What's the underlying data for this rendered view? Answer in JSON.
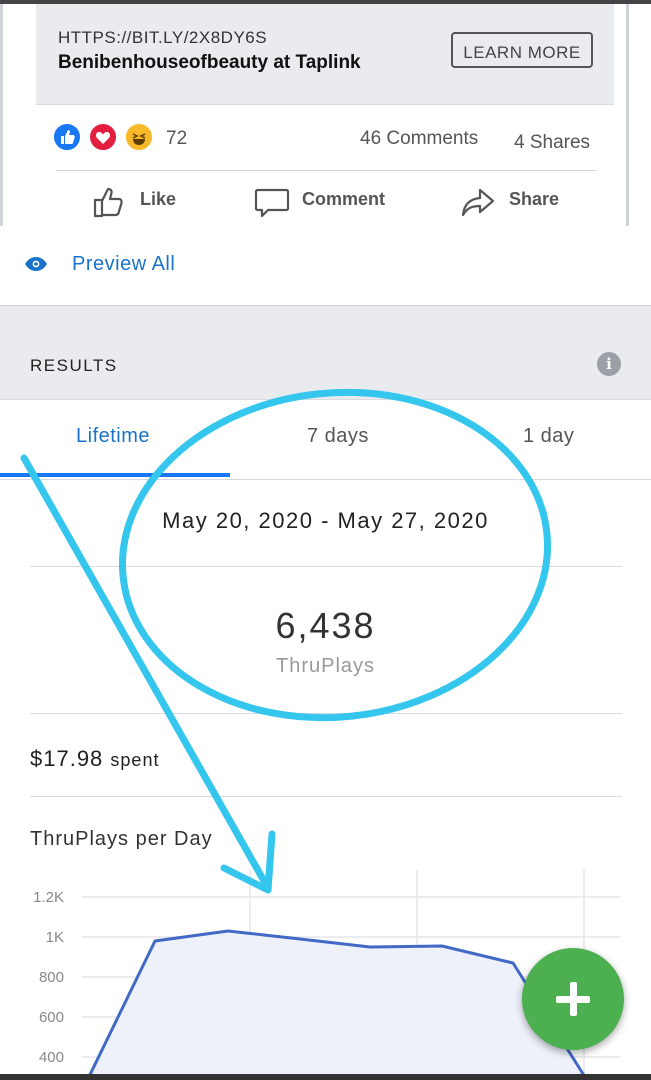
{
  "ad_post": {
    "link_url": "HTTPS://BIT.LY/2X8DY6S",
    "link_title": "Benibenhouseofbeauty at Taplink",
    "cta_label": "LEARN MORE",
    "reaction_icons": [
      "like-icon",
      "love-icon",
      "haha-icon"
    ],
    "reaction_count": "72",
    "comments": "46 Comments",
    "shares": "4 Shares",
    "actions": {
      "like": "Like",
      "comment": "Comment",
      "share": "Share"
    }
  },
  "preview": {
    "label": "Preview All",
    "icon": "eye-icon"
  },
  "results": {
    "title": "RESULTS",
    "info_icon": "i",
    "tabs": [
      "Lifetime",
      "7 days",
      "1 day"
    ],
    "active_tab": "Lifetime",
    "date_range": "May 20, 2020 - May 27, 2020",
    "metric_value": "6,438",
    "metric_label": "ThruPlays",
    "spent_amount": "$17.98",
    "spent_label": "spent",
    "chart_title": "ThruPlays per Day"
  },
  "colors": {
    "accent_blue": "#1a73c8",
    "tab_underline": "#1877f2",
    "line": "#4169c6",
    "area_fill": "#eef1fa",
    "fab": "#4caf50",
    "annotation": "#35c6ee"
  },
  "chart_data": {
    "type": "area",
    "title": "ThruPlays per Day",
    "xlabel": "",
    "ylabel": "",
    "y_tick_labels": [
      "1.2K",
      "1K",
      "800",
      "600",
      "400"
    ],
    "y_ticks": [
      1200,
      1000,
      800,
      600,
      400
    ],
    "ylim": [
      400,
      1200
    ],
    "grid": true,
    "series": [
      {
        "values": [
          250,
          980,
          1030,
          990,
          950,
          955,
          870,
          300
        ]
      }
    ]
  }
}
